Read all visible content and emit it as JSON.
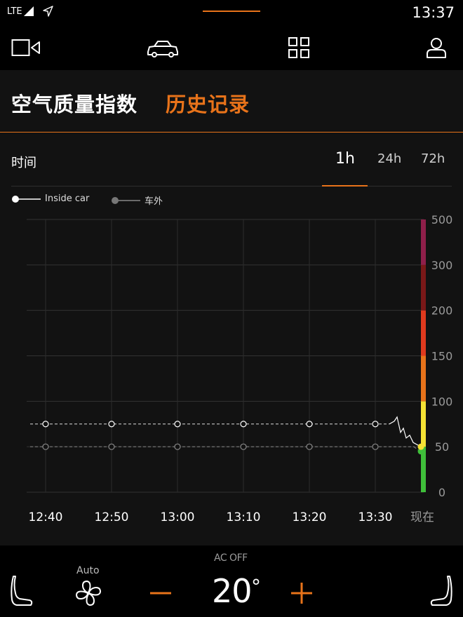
{
  "status_bar": {
    "network": "LTE",
    "time": "13:37"
  },
  "top_nav": {
    "icons": [
      "camera-icon",
      "car-icon",
      "grid-icon",
      "profile-icon"
    ]
  },
  "header_tabs": {
    "aqi": "空气质量指数",
    "history": "历史记录",
    "active": "history"
  },
  "time_range": {
    "label": "时间",
    "options": [
      "1h",
      "24h",
      "72h"
    ],
    "selected": "1h"
  },
  "legend": {
    "inside": "Inside car",
    "outside": "车外"
  },
  "colors": {
    "accent": "#e8731a",
    "background": "#121212"
  },
  "chart_data": {
    "type": "line",
    "x": [
      "12:40",
      "12:50",
      "13:00",
      "13:10",
      "13:20",
      "13:30",
      "现在"
    ],
    "y_ticks": [
      0,
      50,
      100,
      150,
      200,
      300,
      500
    ],
    "scale_bands": [
      {
        "from": 0,
        "to": 50,
        "color": "#3fbf3a"
      },
      {
        "from": 50,
        "to": 100,
        "color": "#f5e234"
      },
      {
        "from": 100,
        "to": 150,
        "color": "#e8731a"
      },
      {
        "from": 150,
        "to": 200,
        "color": "#e03a1e"
      },
      {
        "from": 200,
        "to": 300,
        "color": "#7a1818"
      },
      {
        "from": 300,
        "to": 500,
        "color": "#8f1f4a"
      }
    ],
    "series": [
      {
        "name": "Inside car",
        "values": [
          75,
          75,
          75,
          75,
          75,
          75,
          50
        ]
      },
      {
        "name": "车外",
        "values": [
          50,
          50,
          50,
          50,
          50,
          50,
          45
        ]
      }
    ],
    "grid": true
  },
  "climate": {
    "ac": "AC OFF",
    "fan_mode": "Auto",
    "temperature": "20",
    "temp_unit": "°"
  }
}
